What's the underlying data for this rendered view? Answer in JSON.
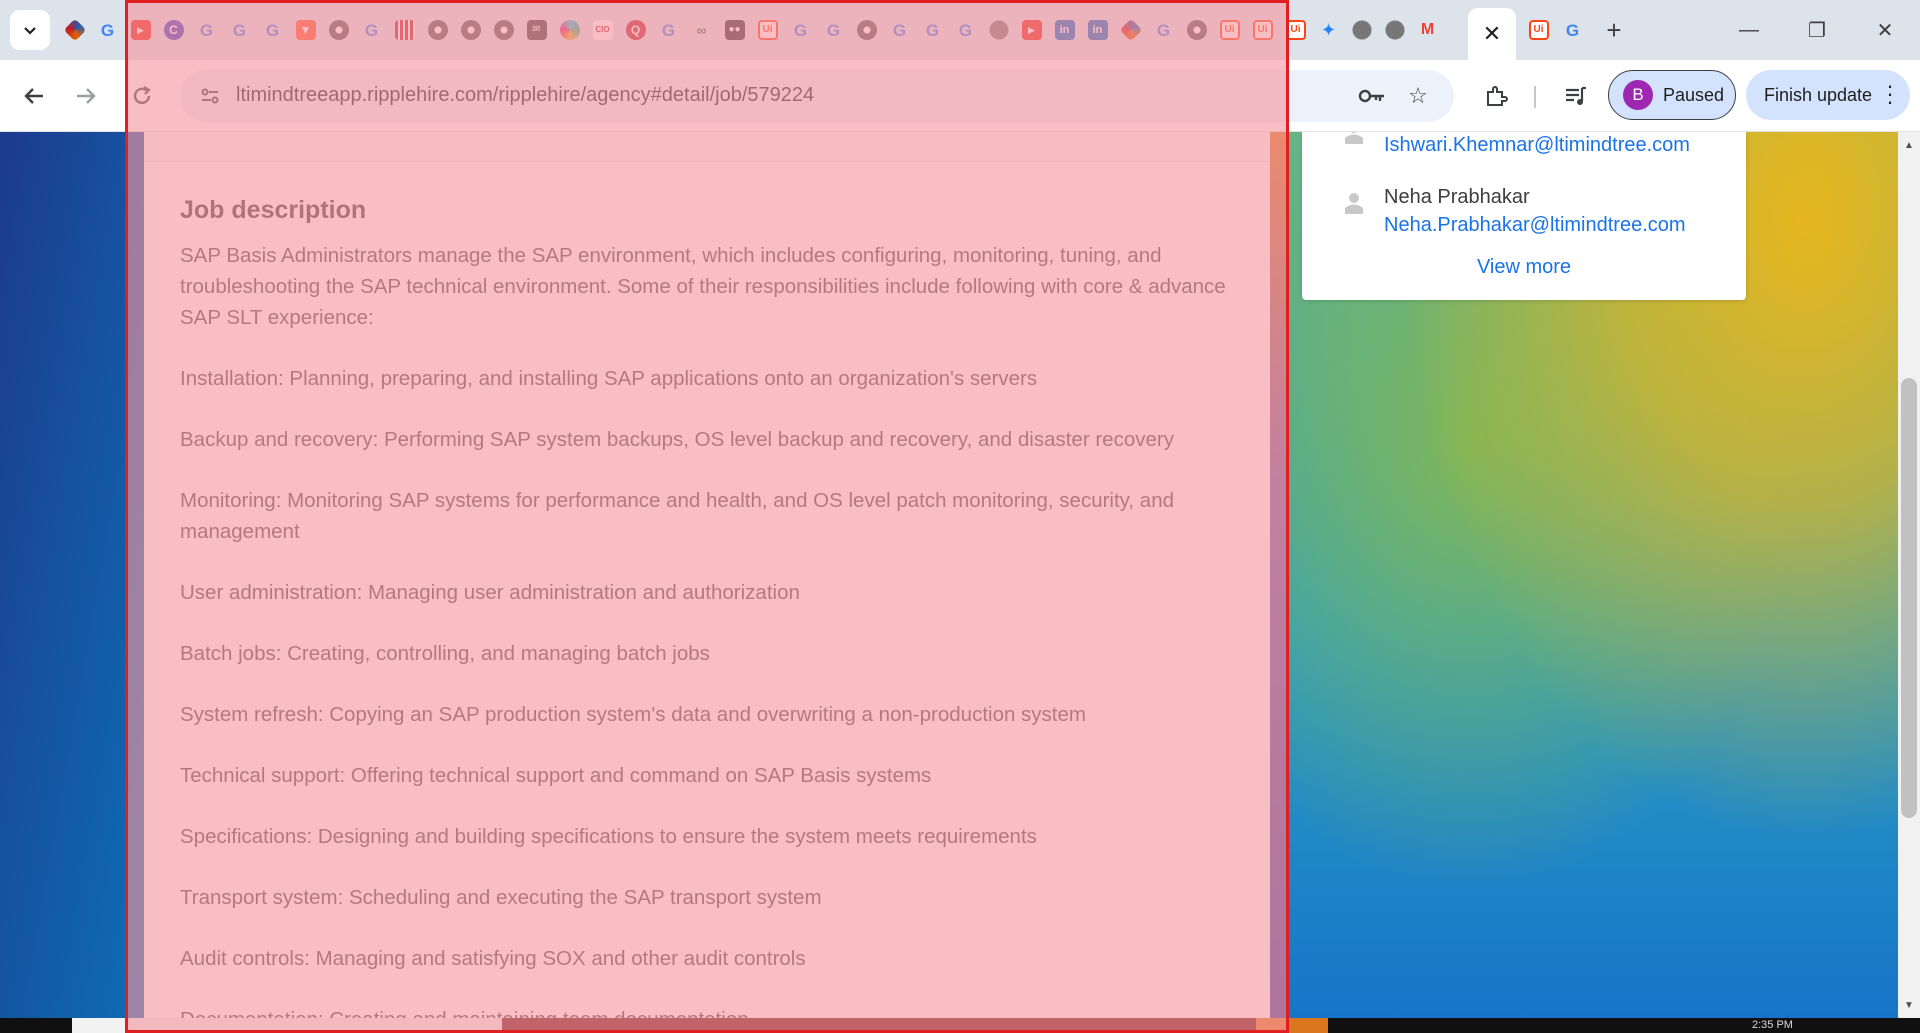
{
  "browser": {
    "tab_strip": {
      "favicons": [
        "ltimindtree-icon",
        "google-icon",
        "youtube-icon",
        "c-icon",
        "google-icon",
        "google-icon",
        "google-icon",
        "brave-icon",
        "chrome-icon",
        "google-icon",
        "qr-icon",
        "chrome-icon",
        "chrome-icon",
        "chrome-icon",
        "mail-icon",
        "slack-icon",
        "cio-icon",
        "q-icon",
        "google-icon",
        "link-icon",
        "mailbox-icon",
        "uipath-icon",
        "google-icon",
        "google-icon",
        "chrome-icon",
        "google-icon",
        "google-icon",
        "google-icon",
        "globe-icon",
        "youtube-icon",
        "linkedin-icon",
        "linkedin-icon",
        "ltimindtree-icon",
        "google-icon",
        "chrome-icon",
        "uipath-icon",
        "uipath-icon",
        "uipath-icon",
        "jira-icon",
        "globe-icon",
        "globe-icon",
        "gmail-icon"
      ],
      "active_tab_close": "✕",
      "after_active_favicons": [
        "uipath-icon",
        "google-icon"
      ],
      "new_tab": "+",
      "window_minimize": "—",
      "window_restore": "❐",
      "window_close": "✕"
    },
    "toolbar": {
      "url": "ltimindtree​app.ripplehire.com/ripplehire/agency#detail/job/579224",
      "profile_initial": "B",
      "profile_status": "Paused",
      "finish_update_label": "Finish update"
    }
  },
  "job": {
    "section_title": "Job description",
    "paragraphs": [
      "SAP Basis Administrators manage the SAP environment, which includes configuring, monitoring, tuning, and troubleshooting the SAP technical environment. Some of their responsibilities include following with core & advance SAP SLT experience:",
      "Installation: Planning, preparing, and installing SAP applications onto an organization's servers",
      "Backup and recovery: Performing SAP system backups, OS level backup and recovery, and disaster recovery",
      "Monitoring: Monitoring SAP systems for performance and health, and OS level patch monitoring, security, and management",
      "User administration: Managing user administration and authorization",
      "Batch jobs: Creating, controlling, and managing batch jobs",
      "System refresh: Copying an SAP production system's data and overwriting a non-production system",
      "Technical support: Offering technical support and command on SAP Basis systems",
      "Specifications: Designing and building specifications to ensure the system meets requirements",
      "Transport system: Scheduling and executing the SAP transport system",
      "Audit controls: Managing and satisfying SOX and other audit controls",
      "Documentation: Creating and maintaining team documentation"
    ]
  },
  "contacts": {
    "items": [
      {
        "name": "",
        "email": "Ishwari.Khemnar@ltimindtree.com"
      },
      {
        "name": "Neha Prabhakar",
        "email": "Neha.Prabhakar@ltimindtree.com"
      }
    ],
    "view_more": "View more"
  },
  "taskbar": {
    "clock": "2:35 PM"
  },
  "colors": {
    "overlay": "#f696a0",
    "overlay_border": "#e02020",
    "link": "#1a73e8",
    "chip_bg": "#d3e3fd"
  }
}
